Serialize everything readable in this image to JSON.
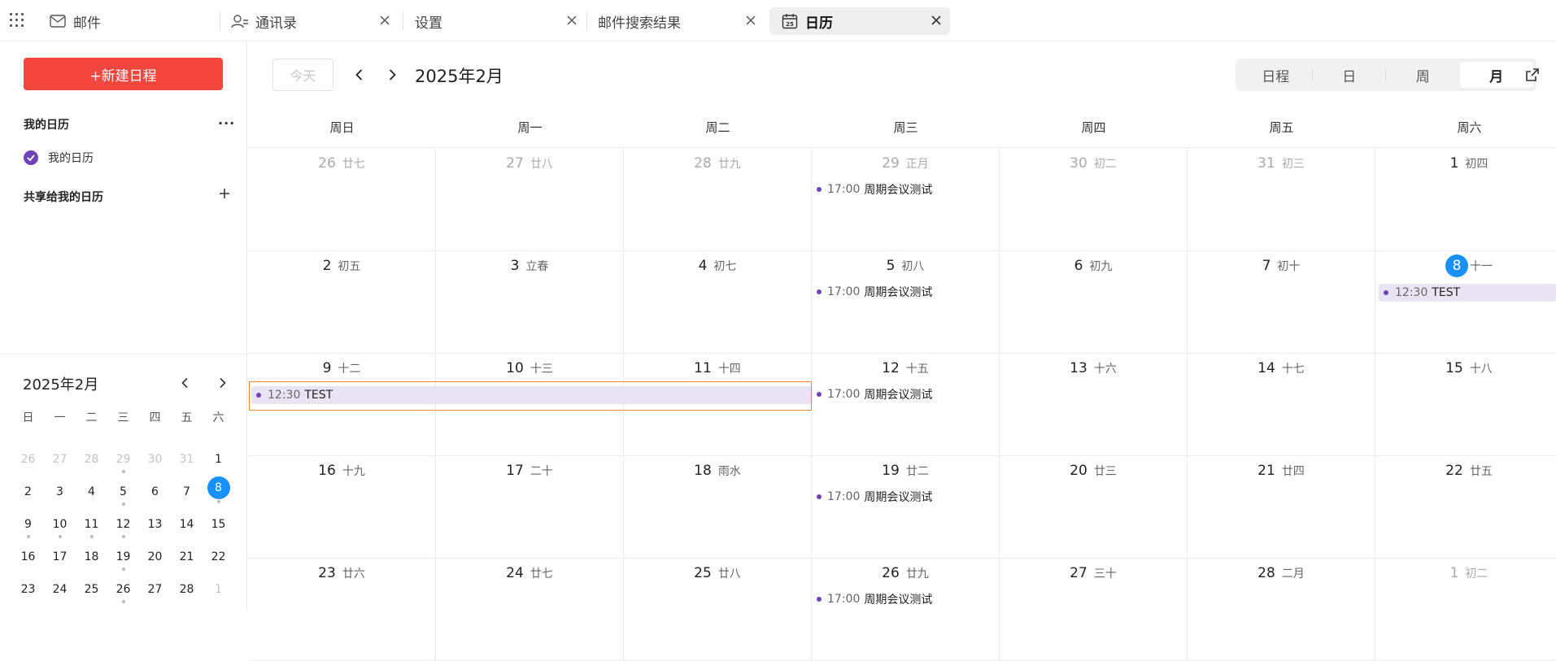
{
  "tabs": [
    {
      "label": "邮件",
      "icon": "mail-icon"
    },
    {
      "label": "通讯录",
      "icon": "contacts-icon"
    },
    {
      "label": "设置",
      "icon": null
    },
    {
      "label": "邮件搜索结果",
      "icon": null
    },
    {
      "label": "日历",
      "icon": "calendar-icon",
      "icon_text": "25",
      "active": true
    }
  ],
  "sidebar": {
    "new_button": "+新建日程",
    "my_calendars_heading": "我的日历",
    "more_glyph": "···",
    "my_calendar_item": "我的日历",
    "shared_heading": "共享给我的日历"
  },
  "mini_calendar": {
    "title": "2025年2月",
    "weekdays": [
      "日",
      "一",
      "二",
      "三",
      "四",
      "五",
      "六"
    ],
    "weeks": [
      [
        {
          "n": "26",
          "o": true
        },
        {
          "n": "27",
          "o": true
        },
        {
          "n": "28",
          "o": true
        },
        {
          "n": "29",
          "o": true,
          "dot": true
        },
        {
          "n": "30",
          "o": true
        },
        {
          "n": "31",
          "o": true
        },
        {
          "n": "1"
        }
      ],
      [
        {
          "n": "2"
        },
        {
          "n": "3"
        },
        {
          "n": "4"
        },
        {
          "n": "5",
          "dot": true
        },
        {
          "n": "6"
        },
        {
          "n": "7"
        },
        {
          "n": "8",
          "today": true,
          "dot": true
        }
      ],
      [
        {
          "n": "9",
          "dot": true
        },
        {
          "n": "10",
          "dot": true
        },
        {
          "n": "11",
          "dot": true
        },
        {
          "n": "12",
          "dot": true
        },
        {
          "n": "13"
        },
        {
          "n": "14"
        },
        {
          "n": "15"
        }
      ],
      [
        {
          "n": "16"
        },
        {
          "n": "17"
        },
        {
          "n": "18"
        },
        {
          "n": "19",
          "dot": true
        },
        {
          "n": "20"
        },
        {
          "n": "21"
        },
        {
          "n": "22"
        }
      ],
      [
        {
          "n": "23"
        },
        {
          "n": "24"
        },
        {
          "n": "25"
        },
        {
          "n": "26",
          "dot": true
        },
        {
          "n": "27"
        },
        {
          "n": "28"
        },
        {
          "n": "1",
          "o": true
        }
      ]
    ]
  },
  "toolbar": {
    "today_label": "今天",
    "month_title": "2025年2月",
    "views": [
      "日程",
      "日",
      "周",
      "月"
    ],
    "active_view": "月"
  },
  "week_header": [
    "周日",
    "周一",
    "周二",
    "周三",
    "周四",
    "周五",
    "周六"
  ],
  "month": [
    [
      {
        "d": "26",
        "l": "廿七",
        "o": true
      },
      {
        "d": "27",
        "l": "廿八",
        "o": true
      },
      {
        "d": "28",
        "l": "廿九",
        "o": true
      },
      {
        "d": "29",
        "l": "正月",
        "o": true,
        "event": {
          "time": "17:00",
          "title": "周期会议测试"
        }
      },
      {
        "d": "30",
        "l": "初二",
        "o": true
      },
      {
        "d": "31",
        "l": "初三",
        "o": true
      },
      {
        "d": "1",
        "l": "初四"
      }
    ],
    [
      {
        "d": "2",
        "l": "初五"
      },
      {
        "d": "3",
        "l": "立春"
      },
      {
        "d": "4",
        "l": "初七"
      },
      {
        "d": "5",
        "l": "初八",
        "event": {
          "time": "17:00",
          "title": "周期会议测试"
        }
      },
      {
        "d": "6",
        "l": "初九"
      },
      {
        "d": "7",
        "l": "初十"
      },
      {
        "d": "8",
        "l": "十一",
        "today": true
      }
    ],
    [
      {
        "d": "9",
        "l": "十二"
      },
      {
        "d": "10",
        "l": "十三"
      },
      {
        "d": "11",
        "l": "十四"
      },
      {
        "d": "12",
        "l": "十五",
        "event": {
          "time": "17:00",
          "title": "周期会议测试"
        }
      },
      {
        "d": "13",
        "l": "十六"
      },
      {
        "d": "14",
        "l": "十七"
      },
      {
        "d": "15",
        "l": "十八"
      }
    ],
    [
      {
        "d": "16",
        "l": "十九"
      },
      {
        "d": "17",
        "l": "二十"
      },
      {
        "d": "18",
        "l": "雨水"
      },
      {
        "d": "19",
        "l": "廿二",
        "event": {
          "time": "17:00",
          "title": "周期会议测试"
        }
      },
      {
        "d": "20",
        "l": "廿三"
      },
      {
        "d": "21",
        "l": "廿四"
      },
      {
        "d": "22",
        "l": "廿五"
      }
    ],
    [
      {
        "d": "23",
        "l": "廿六"
      },
      {
        "d": "24",
        "l": "廿七"
      },
      {
        "d": "25",
        "l": "廿八"
      },
      {
        "d": "26",
        "l": "廿九",
        "event": {
          "time": "17:00",
          "title": "周期会议测试"
        }
      },
      {
        "d": "27",
        "l": "三十"
      },
      {
        "d": "28",
        "l": "二月"
      },
      {
        "d": "1",
        "l": "初二",
        "o": true
      }
    ]
  ],
  "multi_day_events": [
    {
      "time": "12:30",
      "title": "TEST",
      "start_date": "2月8日",
      "end_date": "2月8日"
    },
    {
      "time": "12:30",
      "title": "TEST",
      "start_date": "2月9日",
      "end_date": "2月11日",
      "selected": true
    }
  ],
  "colors": {
    "accent_red": "#f2463f",
    "event_purple": "#6e44b6",
    "today_blue": "#1890ff",
    "selection_orange": "#f08a33"
  }
}
